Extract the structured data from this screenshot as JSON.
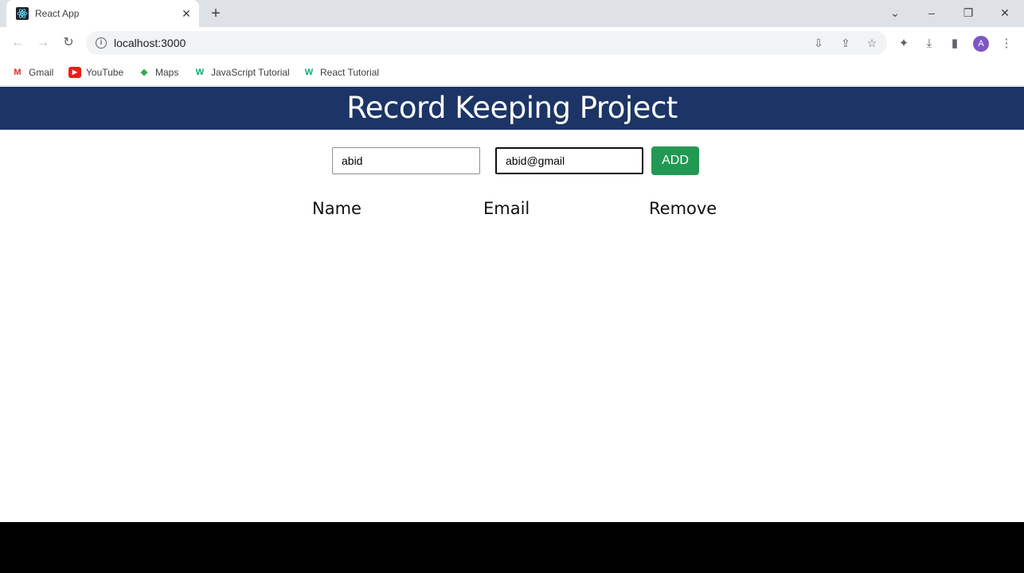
{
  "browser": {
    "tab_title": "React App",
    "url": "localhost:3000",
    "avatar_letter": "A"
  },
  "bookmarks": [
    {
      "label": "Gmail",
      "icon": "gmail-icon"
    },
    {
      "label": "YouTube",
      "icon": "youtube-icon"
    },
    {
      "label": "Maps",
      "icon": "maps-icon"
    },
    {
      "label": "JavaScript Tutorial",
      "icon": "w3schools-icon"
    },
    {
      "label": "React Tutorial",
      "icon": "w3schools-icon"
    }
  ],
  "app": {
    "title": "Record Keeping Project",
    "form": {
      "name_value": "abid",
      "email_value": "abid@gmail",
      "add_label": "ADD"
    },
    "table": {
      "columns": [
        "Name",
        "Email",
        "Remove"
      ]
    }
  },
  "colors": {
    "header": "#1c3466",
    "add_button": "#229952"
  }
}
